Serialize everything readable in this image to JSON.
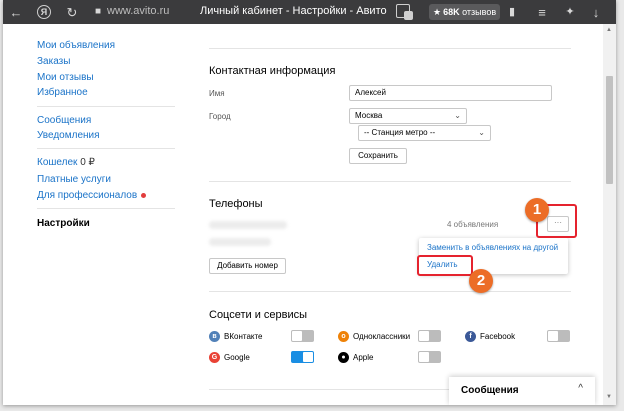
{
  "browser": {
    "url": "www.avito.ru",
    "title": "Личный кабинет - Настройки - Авито",
    "reviews_star": "★",
    "reviews_count": "68K",
    "reviews_label": "отзывов",
    "icons": [
      "back-icon",
      "yandex-icon",
      "refresh-icon",
      "lock-icon",
      "tab-icon",
      "bookmark-icon",
      "menu-icon",
      "extension-icon",
      "download-icon"
    ]
  },
  "sidebar": {
    "group1": [
      "Мои объявления",
      "Заказы",
      "Мои отзывы",
      "Избранное"
    ],
    "group2": [
      "Сообщения",
      "Уведомления"
    ],
    "wallet_label": "Кошелек",
    "wallet_value": "0 ₽",
    "paid_services": "Платные услуги",
    "for_pros": "Для профессионалов",
    "settings": "Настройки"
  },
  "contact": {
    "heading": "Контактная информация",
    "name_label": "Имя",
    "name_value": "Алексей",
    "city_label": "Город",
    "city_value": "Москва",
    "metro_value": "-- Станция метро --",
    "save_label": "Сохранить"
  },
  "phones": {
    "heading": "Телефоны",
    "ads_count": "4 объявления",
    "more_label": "···",
    "menu": {
      "replace": "Заменить в объявлениях на другой",
      "delete": "Удалить"
    },
    "add_label": "Добавить номер"
  },
  "markers": [
    "1",
    "2"
  ],
  "social": {
    "heading": "Соцсети и сервисы",
    "items": [
      {
        "name": "ВКонтакте",
        "letter": "в",
        "color": "#5181b8",
        "enabled": false
      },
      {
        "name": "Одноклассники",
        "letter": "о",
        "color": "#ee8208",
        "enabled": false
      },
      {
        "name": "Facebook",
        "letter": "f",
        "color": "#3b5998",
        "enabled": false
      },
      {
        "name": "Google",
        "letter": "G",
        "color": "#e94235",
        "enabled": true
      },
      {
        "name": "Apple",
        "letter": "",
        "color": "#000000",
        "enabled": false
      }
    ]
  },
  "messages_panel": {
    "title": "Сообщения",
    "chevron": "^"
  },
  "colors": {
    "accent": "#1a73c8",
    "highlight": "#e5232e",
    "marker": "#ec6d27",
    "toggle_on": "#1a8ee3"
  }
}
